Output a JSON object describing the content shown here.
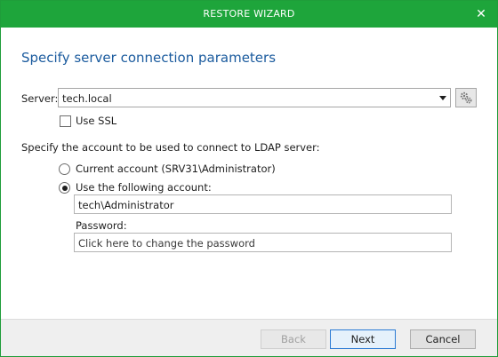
{
  "window": {
    "title": "RESTORE WIZARD",
    "close_glyph": "✕"
  },
  "page": {
    "heading": "Specify server connection parameters"
  },
  "server": {
    "label": "Server:",
    "value": "tech.local",
    "use_ssl_label": "Use SSL",
    "use_ssl_checked": false
  },
  "account": {
    "prompt": "Specify the account to be used to connect to LDAP server:",
    "current_label": "Current account (SRV31\\Administrator)",
    "following_label": "Use the following account:",
    "selected": "following",
    "username_value": "tech\\Administrator",
    "password_label": "Password:",
    "password_placeholder": "Click here to change the password"
  },
  "buttons": {
    "back": "Back",
    "next": "Next",
    "cancel": "Cancel"
  },
  "colors": {
    "titlebar": "#1ea53b",
    "heading": "#1b5b9e"
  }
}
